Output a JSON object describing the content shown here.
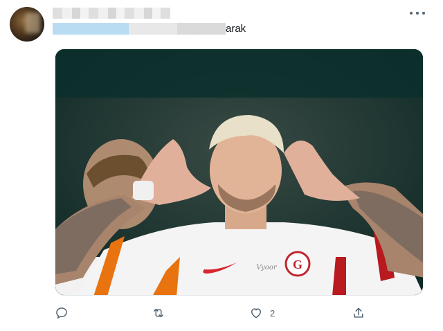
{
  "tweet": {
    "text_fragment": "arak",
    "like_count": "2"
  },
  "media": {
    "jersey_script": "Vyoor"
  },
  "colors": {
    "icon": "#536471",
    "jersey_stripe_orange": "#e8730f",
    "jersey_stripe_red": "#b81a1f"
  }
}
